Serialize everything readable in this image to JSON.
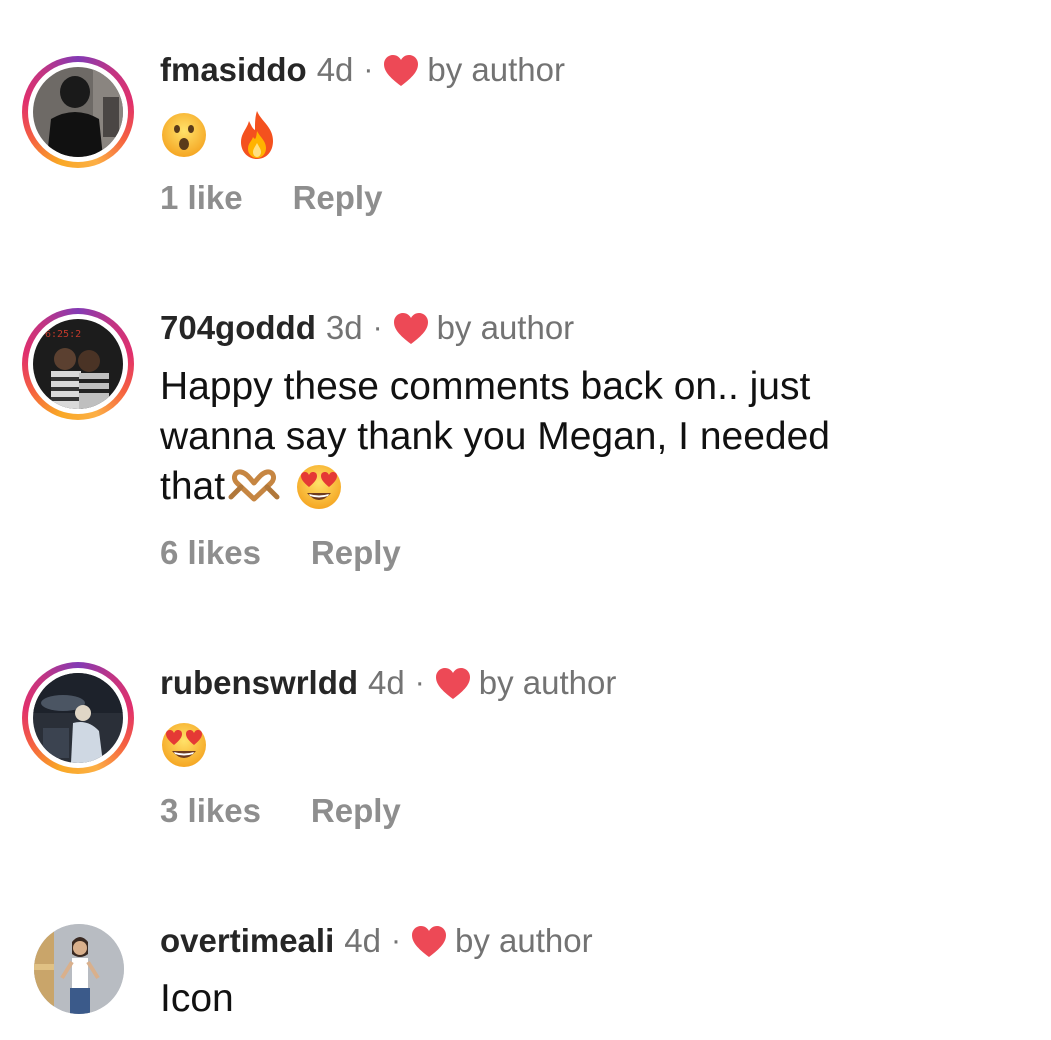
{
  "comments": [
    {
      "username": "fmasiddo",
      "time": "4d",
      "separator": "·",
      "liked_by": "by author",
      "text": "",
      "emoji": [
        "face-open-mouth-emoji",
        "fire-emoji"
      ],
      "likes": "1 like",
      "reply": "Reply",
      "avatar_ring": "story-gradient"
    },
    {
      "username": "704goddd",
      "time": "3d",
      "separator": "·",
      "liked_by": "by author",
      "text_line1": "Happy these comments back on.. just",
      "text_line2": "wanna say thank you Megan, I needed",
      "text_line3": "that",
      "emoji": [
        "heart-hands-emoji",
        "heart-eyes-emoji"
      ],
      "likes": "6 likes",
      "reply": "Reply",
      "avatar_ring": "story-gradient"
    },
    {
      "username": "rubenswrldd",
      "time": "4d",
      "separator": "·",
      "liked_by": "by author",
      "text": "",
      "emoji": [
        "heart-eyes-emoji"
      ],
      "likes": "3 likes",
      "reply": "Reply",
      "avatar_ring": "story-gradient"
    },
    {
      "username": "overtimeali",
      "time": "4d",
      "separator": "·",
      "liked_by": "by author",
      "text": "Icon",
      "avatar_ring": "none"
    }
  ],
  "colors": {
    "username": "#262626",
    "meta_gray": "#737373",
    "action_gray": "#8e8e8e",
    "heart_red": "#ed4956",
    "text": "#111111"
  }
}
